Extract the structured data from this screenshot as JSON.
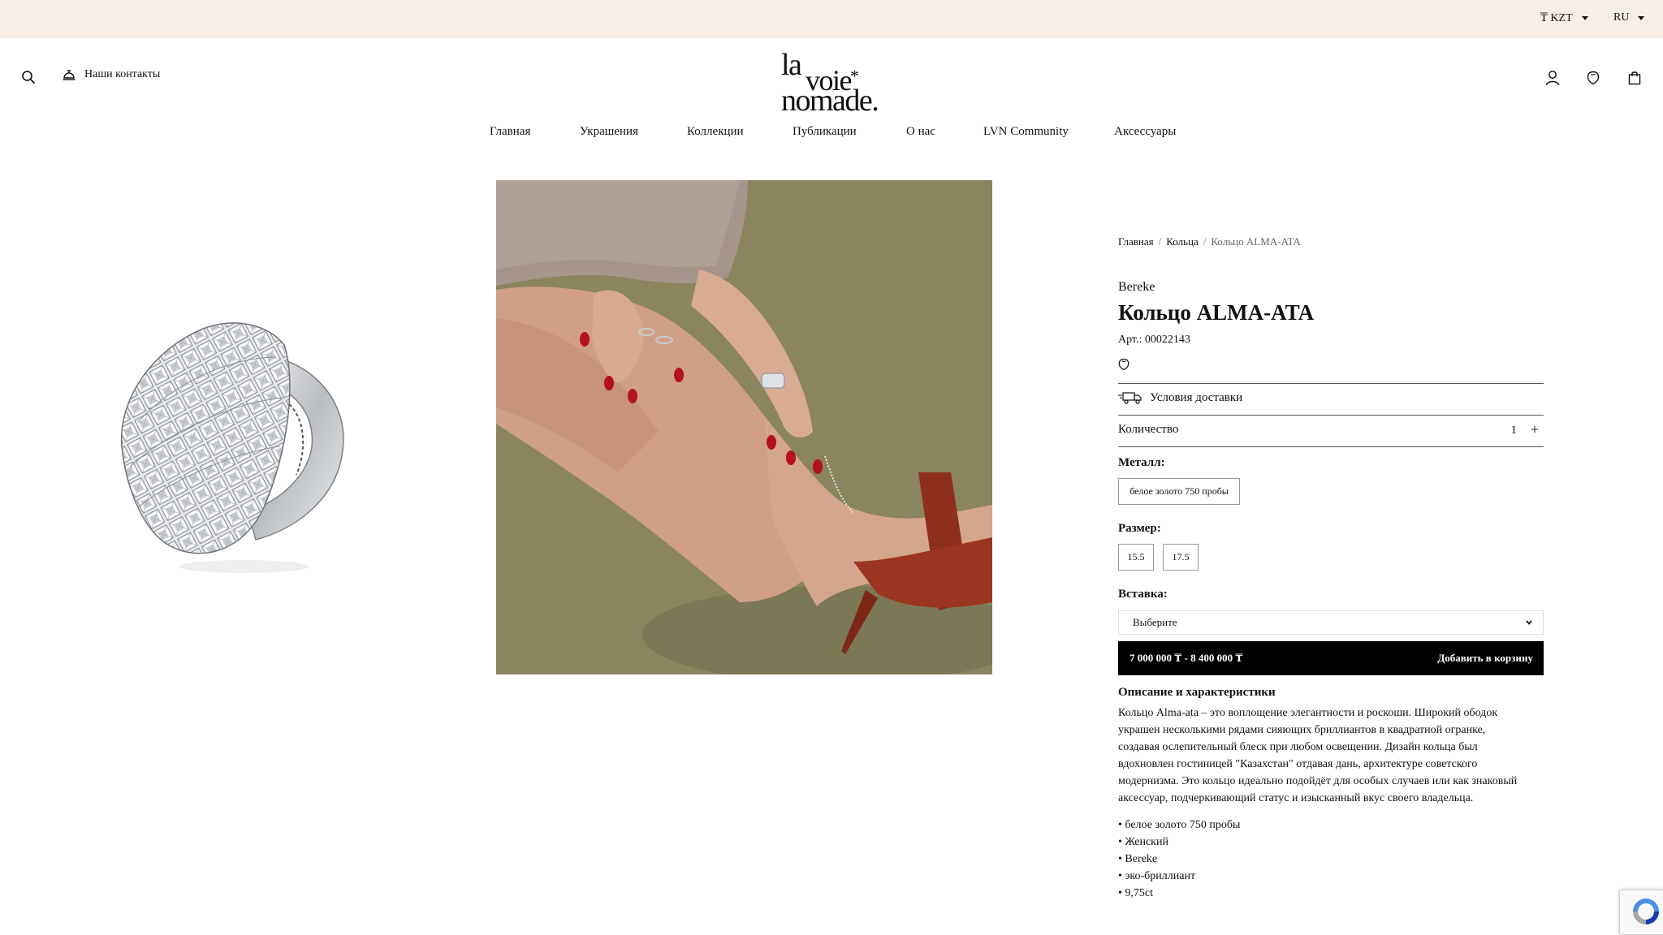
{
  "topbar": {
    "currency": "₸ KZT",
    "language": "RU"
  },
  "header": {
    "contacts_label": "Наши контакты",
    "logo": {
      "line1": "la",
      "line2": "voie",
      "star": "*",
      "line3": "nomade."
    }
  },
  "nav": {
    "items": [
      {
        "label": "Главная"
      },
      {
        "label": "Украшения"
      },
      {
        "label": "Коллекции"
      },
      {
        "label": "Публикации"
      },
      {
        "label": "О нас"
      },
      {
        "label": "LVN Community"
      },
      {
        "label": "Аксессуары"
      }
    ]
  },
  "breadcrumb": {
    "home": "Главная",
    "category": "Кольца",
    "current": "Кольцо ALMA-ATA",
    "separator": "/"
  },
  "product": {
    "brand": "Bereke",
    "title": "Кольцо ALMA-ATA",
    "sku": "Арт.: 00022143",
    "delivery_label": "Условия доставки",
    "quantity_label": "Количество",
    "quantity_value": "1",
    "quantity_plus": "+",
    "metal_label": "Металл:",
    "metal_option": "белое золото 750 пробы",
    "size_label": "Размер:",
    "sizes": [
      "15.5",
      "17.5"
    ],
    "insert_label": "Вставка:",
    "insert_placeholder": "Выберите",
    "price_range": "7 000 000 ₸ - 8 400 000 ₸",
    "add_to_cart": "Добавить в корзину",
    "description_title": "Описание и характеристики",
    "description_lines": [
      "Кольцо Alma-ata – это воплощение элегантности и роскоши. Широкий ободок",
      "украшен несколькими рядами сияющих бриллиантов в квадратной огранке,",
      "создавая ослепительный блеск при любом освещении.  Дизайн кольца был",
      "вдохновлен гостиницей \"Казахстан\" отдавая дань, архитектуре советского",
      "модернизма. Это кольцо идеально подойдёт для особых случаев или как знаковый",
      "аксессуар, подчеркивающий статус и изысканный вкус своего владельца."
    ],
    "specs": [
      "белое золото 750 пробы",
      "Женский",
      "Bereke",
      "эко-бриллиант",
      "9,75ct"
    ]
  },
  "colors": {
    "topbar_bg": "#f7efe7",
    "button_bg": "#000000",
    "photo_bg": "#857f5b",
    "nail_red": "#b3121c",
    "heel_red": "#8e2e1c"
  }
}
